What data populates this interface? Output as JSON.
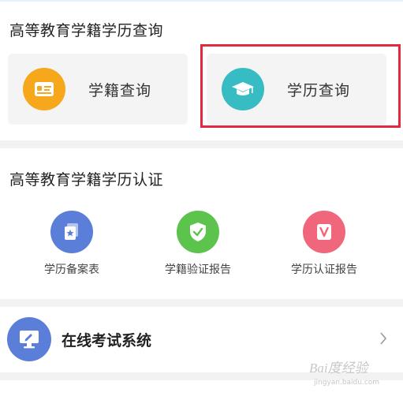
{
  "colors": {
    "orange": "#f6a71c",
    "teal": "#37bcc3",
    "blue": "#5b7ed8",
    "green": "#5cc44d",
    "pink": "#f0667a",
    "highlight": "#e4283d"
  },
  "query_section": {
    "title": "高等教育学籍学历查询",
    "cards": [
      {
        "label": "学籍查询",
        "icon": "id-card-icon"
      },
      {
        "label": "学历查询",
        "icon": "graduation-cap-icon"
      }
    ]
  },
  "cert_section": {
    "title": "高等教育学籍学历认证",
    "items": [
      {
        "label": "学历备案表",
        "icon": "document-star-icon"
      },
      {
        "label": "学籍验证报告",
        "icon": "shield-check-icon"
      },
      {
        "label": "学历认证报告",
        "icon": "v-badge-icon"
      }
    ]
  },
  "exam": {
    "label": "在线考试系统",
    "icon": "monitor-icon"
  },
  "watermark": {
    "text": "Bai度经验",
    "sub": "jingyan.baidu.com"
  }
}
